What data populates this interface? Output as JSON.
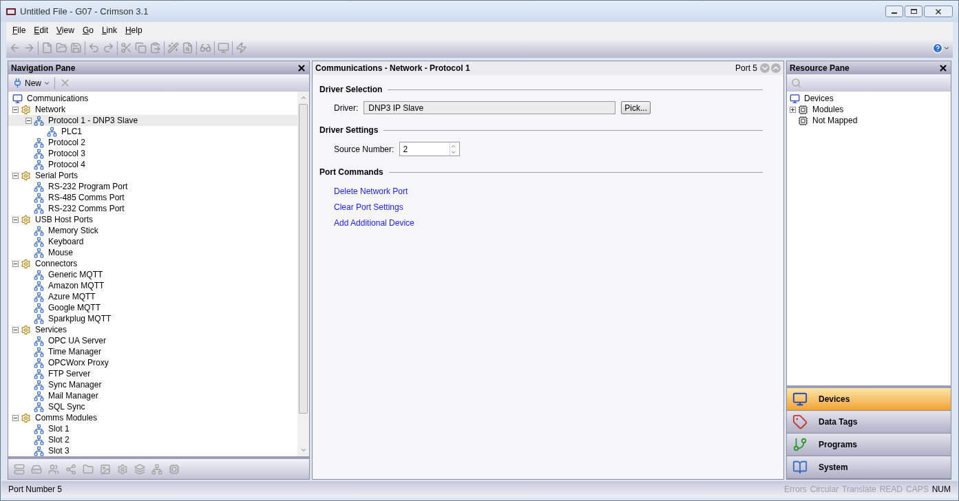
{
  "window": {
    "title": "Untitled File - G07 - Crimson 3.1"
  },
  "menu": [
    "File",
    "Edit",
    "View",
    "Go",
    "Link",
    "Help"
  ],
  "navigation_pane": {
    "title": "Navigation Pane",
    "new_button": "New",
    "tree": [
      {
        "label": "Communications",
        "selected": false,
        "children": [
          {
            "label": "Network",
            "selected": false,
            "expanded": true,
            "children": [
              {
                "label": "Protocol 1 - DNP3 Slave",
                "selected": true,
                "expanded": true,
                "children": [
                  {
                    "label": "PLC1",
                    "selected": false
                  }
                ]
              },
              {
                "label": "Protocol 2",
                "selected": false
              },
              {
                "label": "Protocol 3",
                "selected": false
              },
              {
                "label": "Protocol 4",
                "selected": false
              }
            ]
          },
          {
            "label": "Serial Ports",
            "selected": false,
            "expanded": true,
            "children": [
              {
                "label": "RS-232 Program Port",
                "selected": false
              },
              {
                "label": "RS-485 Comms Port",
                "selected": false
              },
              {
                "label": "RS-232 Comms Port",
                "selected": false
              }
            ]
          },
          {
            "label": "USB Host Ports",
            "selected": false,
            "expanded": true,
            "children": [
              {
                "label": "Memory Stick",
                "selected": false
              },
              {
                "label": "Keyboard",
                "selected": false
              },
              {
                "label": "Mouse",
                "selected": false
              }
            ]
          },
          {
            "label": "Connectors",
            "selected": false,
            "expanded": true,
            "children": [
              {
                "label": "Generic MQTT",
                "selected": false
              },
              {
                "label": "Amazon MQTT",
                "selected": false
              },
              {
                "label": "Azure MQTT",
                "selected": false
              },
              {
                "label": "Google MQTT",
                "selected": false
              },
              {
                "label": "Sparkplug MQTT",
                "selected": false
              }
            ]
          },
          {
            "label": "Services",
            "selected": false,
            "expanded": true,
            "children": [
              {
                "label": "OPC UA Server",
                "selected": false
              },
              {
                "label": "Time Manager",
                "selected": false
              },
              {
                "label": "OPCWorx Proxy",
                "selected": false
              },
              {
                "label": "FTP Server",
                "selected": false
              },
              {
                "label": "Sync Manager",
                "selected": false
              },
              {
                "label": "Mail Manager",
                "selected": false
              },
              {
                "label": "SQL Sync",
                "selected": false
              }
            ]
          },
          {
            "label": "Comms Modules",
            "selected": false,
            "expanded": true,
            "children": [
              {
                "label": "Slot 1",
                "selected": false
              },
              {
                "label": "Slot 2",
                "selected": false
              },
              {
                "label": "Slot 3",
                "selected": false
              }
            ]
          }
        ]
      }
    ]
  },
  "editor": {
    "breadcrumb": "Communications - Network - Protocol 1",
    "port": "Port 5",
    "sections": [
      {
        "kind": "driver",
        "title": "Driver Selection",
        "label": "Driver:",
        "value": "DNP3 IP Slave",
        "button": "Pick..."
      },
      {
        "kind": "spinner",
        "title": "Driver Settings",
        "label": "Source Number:",
        "value": "2"
      },
      {
        "kind": "links",
        "title": "Port Commands",
        "links": [
          "Delete Network Port",
          "Clear Port Settings",
          "Add Additional Device"
        ]
      }
    ]
  },
  "resource_pane": {
    "title": "Resource Pane",
    "tree": [
      {
        "label": "Devices",
        "children": [
          {
            "label": "Modules",
            "expanded": false
          },
          {
            "label": "Not Mapped"
          }
        ]
      }
    ],
    "categories": [
      {
        "label": "Devices",
        "selected": true
      },
      {
        "label": "Data Tags",
        "selected": false
      },
      {
        "label": "Programs",
        "selected": false
      },
      {
        "label": "System",
        "selected": false
      }
    ]
  },
  "status_bar": {
    "message": "Port Number 5",
    "indicators": [
      {
        "label": "Errors",
        "on": false
      },
      {
        "label": "Circular",
        "on": false
      },
      {
        "label": "Translate",
        "on": false
      },
      {
        "label": "READ",
        "on": false
      },
      {
        "label": "CAPS",
        "on": false
      },
      {
        "label": "NUM",
        "on": true
      }
    ]
  }
}
